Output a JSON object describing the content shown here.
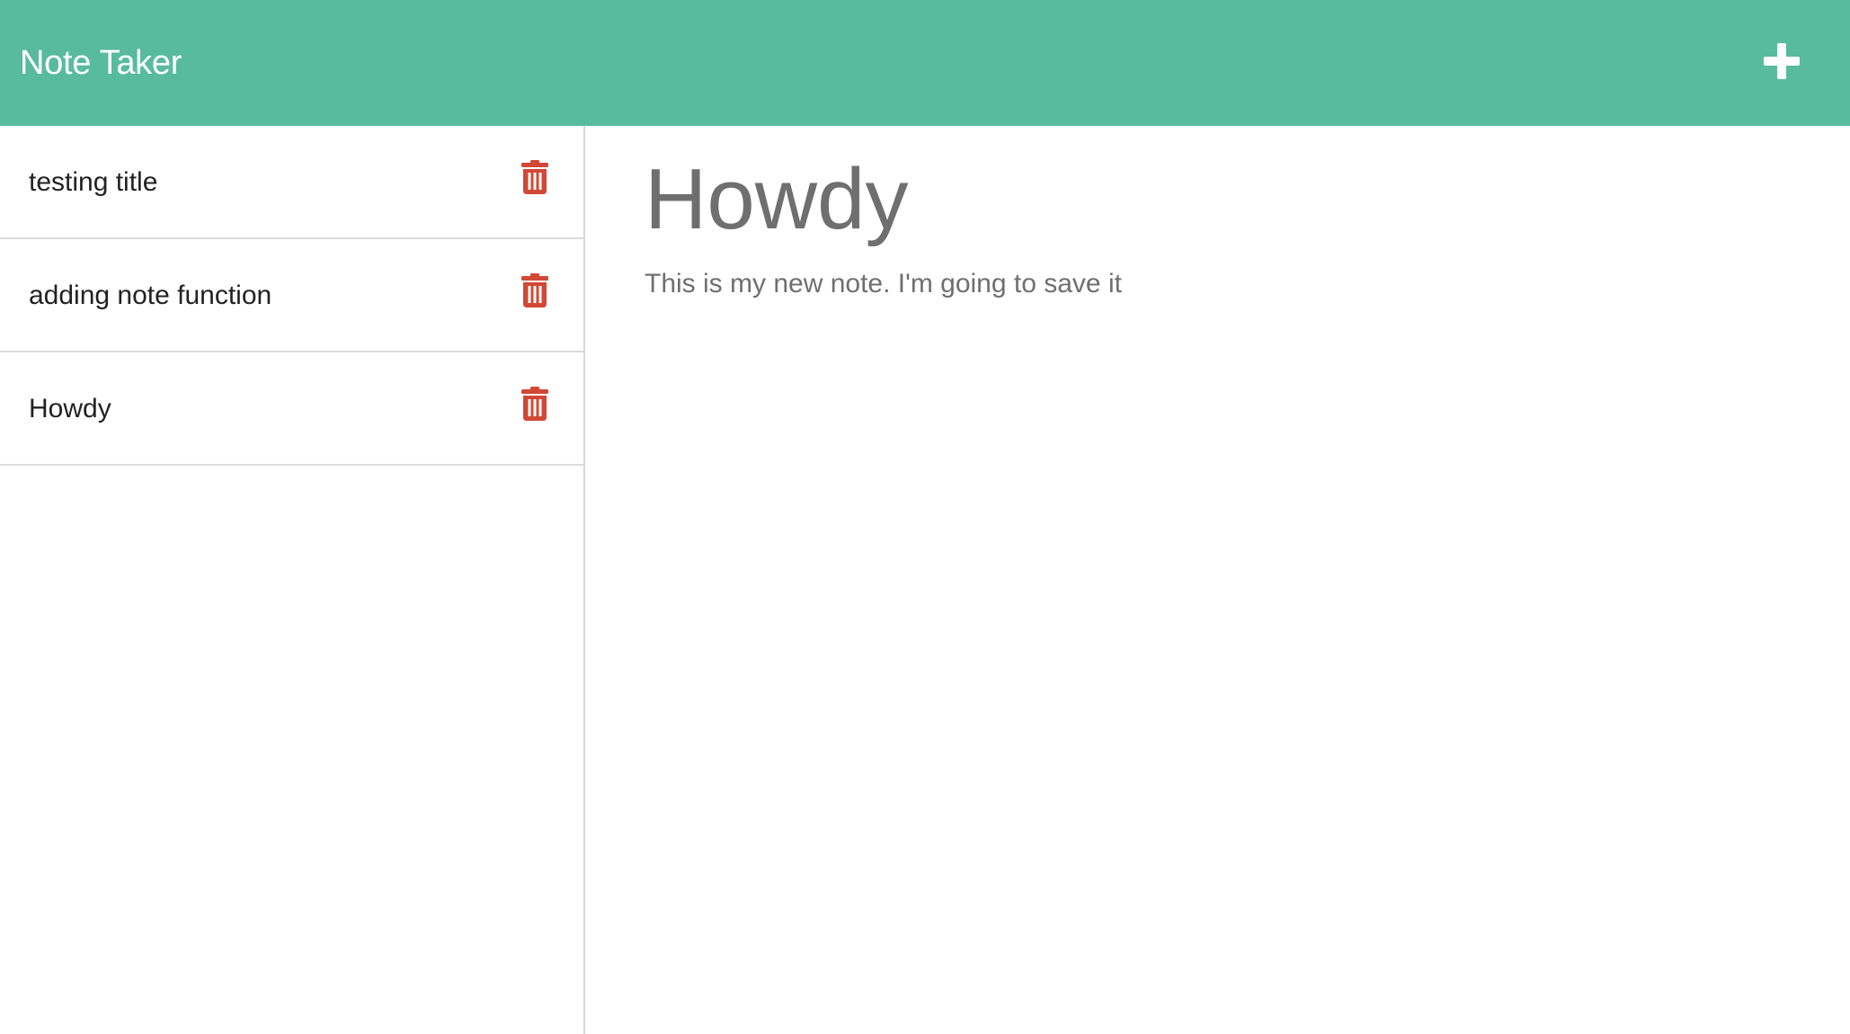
{
  "navbar": {
    "brand": "Note Taker",
    "add_icon": "plus-icon"
  },
  "sidebar": {
    "notes": [
      {
        "title": "testing title",
        "delete_icon": "trash-icon"
      },
      {
        "title": "adding note function",
        "delete_icon": "trash-icon"
      },
      {
        "title": "Howdy",
        "delete_icon": "trash-icon"
      }
    ]
  },
  "main": {
    "note_title": "Howdy",
    "note_text": "This is my new note. I'm going to save it"
  },
  "colors": {
    "navbar_bg": "#58bb9c",
    "delete_icon": "#d14836",
    "note_text": "#6f6f6f"
  }
}
